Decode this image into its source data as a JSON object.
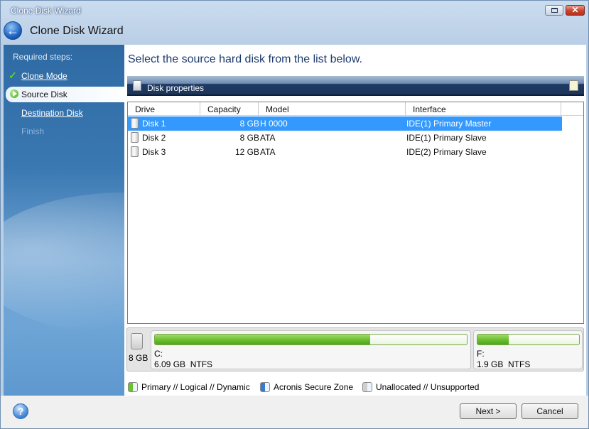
{
  "window": {
    "title": "Clone Disk Wizard",
    "controls": {
      "maximize_icon": "maximize-icon",
      "close_glyph": "✕"
    }
  },
  "header": {
    "title": "Clone Disk Wizard",
    "back_glyph": "←"
  },
  "sidebar": {
    "required_label": "Required steps:",
    "steps": [
      {
        "label": "Clone Mode",
        "state": "done",
        "icon": "checkmark-icon",
        "icon_glyph": "✓"
      },
      {
        "label": "Source Disk",
        "state": "current",
        "icon": "arrow-right-icon"
      },
      {
        "label": "Destination Disk",
        "state": "link"
      },
      {
        "label": "Finish",
        "state": "disabled"
      }
    ]
  },
  "main": {
    "title": "Select the source hard disk from the list below.",
    "properties_label": "Disk properties",
    "columns": [
      "Drive",
      "Capacity",
      "Model",
      "Interface"
    ],
    "rows": [
      {
        "drive": "Disk 1",
        "capacity": "8 GB",
        "model": "H 0000",
        "interface": "IDE(1) Primary Master",
        "selected": true
      },
      {
        "drive": "Disk 2",
        "capacity": "8 GB",
        "model": "ATA",
        "interface": "IDE(1) Primary Slave",
        "selected": false
      },
      {
        "drive": "Disk 3",
        "capacity": "12 GB",
        "model": "ATA",
        "interface": "IDE(2) Primary Slave",
        "selected": false
      }
    ],
    "disk_map": {
      "disk_size": "8 GB",
      "partitions": [
        {
          "letter": "C:",
          "info": "6.09 GB  NTFS",
          "used_fraction": 0.69
        },
        {
          "letter": "F:",
          "info": "1.9 GB  NTFS",
          "used_fraction": 0.31
        }
      ]
    },
    "legend": [
      {
        "label": "Primary // Logical // Dynamic",
        "color": "#6cc132"
      },
      {
        "label": "Acronis Secure Zone",
        "color": "#3a78d2"
      },
      {
        "label": "Unallocated // Unsupported",
        "color": "#cfcfcf"
      }
    ]
  },
  "footer": {
    "help_glyph": "?",
    "next_label": "Next >",
    "cancel_label": "Cancel"
  },
  "colors": {
    "selection": "#3399ff",
    "title_blue": "#1c3a6e"
  }
}
